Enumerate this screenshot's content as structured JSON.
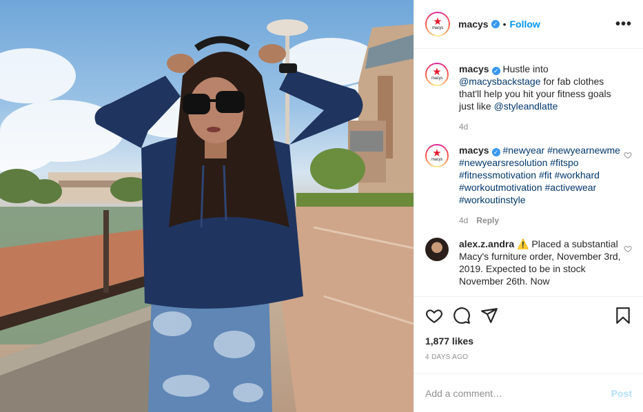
{
  "header": {
    "username": "macys",
    "dot": "•",
    "follow_label": "Follow",
    "more_label": "•••",
    "logo_text": "macys",
    "logo_star": "★"
  },
  "comments": [
    {
      "username": "macys",
      "text_a": "Hustle into ",
      "mention_1": "@macysbackstage",
      "text_b": " for fab clothes that'll help you hit your fitness goals just like ",
      "mention_2": "@styleandlatte",
      "time": "4d"
    },
    {
      "username": "macys",
      "tags": [
        "#newyear",
        "#newyearnewme",
        "#newyearsresolution",
        "#fitspo",
        "#fitnessmotivation",
        "#fit",
        "#workhard",
        "#workoutmotivation",
        "#activewear",
        "#workoutinstyle"
      ],
      "time": "4d",
      "reply_label": "Reply"
    },
    {
      "username": "alex.z.andra",
      "warning": "⚠️",
      "text": "Placed a substantial Macy's furniture order, November 3rd, 2019. Expected to be in stock November 26th. Now"
    }
  ],
  "likes": "1,877 likes",
  "time_ago": "4 DAYS AGO",
  "comment_box": {
    "placeholder": "Add a comment…",
    "post_label": "Post"
  },
  "colors": {
    "accent": "#0095f6",
    "brand_red": "#e21a2c",
    "link": "#00376b",
    "muted": "#8e8e8e"
  },
  "icons": [
    "heart-icon",
    "comment-icon",
    "share-icon",
    "bookmark-icon",
    "verified-icon",
    "more-icon"
  ]
}
